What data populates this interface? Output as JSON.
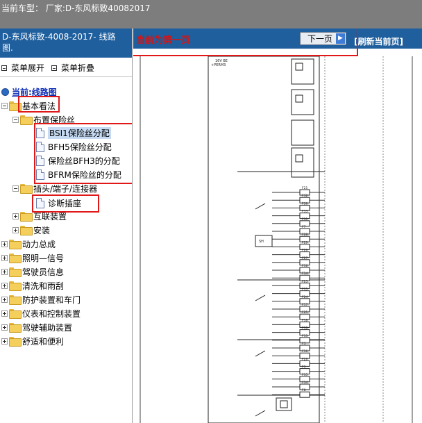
{
  "topbar": {
    "title": "当前车型：  厂家:D-东风标致40082017"
  },
  "left": {
    "header_line1": "D-东风标致-4008-2017- 线路",
    "header_line2": "图.",
    "menu_expand": "菜单展开",
    "menu_collapse": "菜单折叠"
  },
  "tree": {
    "current_label": "当前:线路图",
    "basic": "基本看法",
    "fuse_layout": "布置保险丝",
    "fuse_items": [
      "BSI1保险丝分配",
      "BFH5保险丝分配",
      "保险丝BFH3的分配",
      "BFRM保险丝的分配"
    ],
    "connectors": "插头/端子/连接器",
    "diag_socket": "诊断插座",
    "interconnect": "互联装置",
    "install": "安装",
    "top_groups": [
      "动力总成",
      "照明—信号",
      "驾驶员信息",
      "清洗和雨刮",
      "防护装置和车门",
      "仪表和控制装置",
      "驾驶辅助装置",
      "舒适和便利"
    ]
  },
  "right": {
    "page_label": "当前为第一页",
    "next_button": "下一页",
    "refresh": "[刷新当前页]"
  },
  "diagram": {
    "header_labels": [
      "16V BE",
      "+PERM3"
    ],
    "fuse_labels": [
      "F21",
      "F32",
      "F36",
      "F33",
      "F31",
      "F7",
      "F28",
      "F29",
      "F26",
      "F27",
      "F16",
      "F14",
      "F23",
      "F15",
      "F24",
      "F17",
      "F25",
      "F18",
      "F10",
      "F13",
      "F3",
      "F16",
      "F26",
      "F1",
      "F35",
      "F34",
      "F8"
    ],
    "sh_label": "SH"
  }
}
